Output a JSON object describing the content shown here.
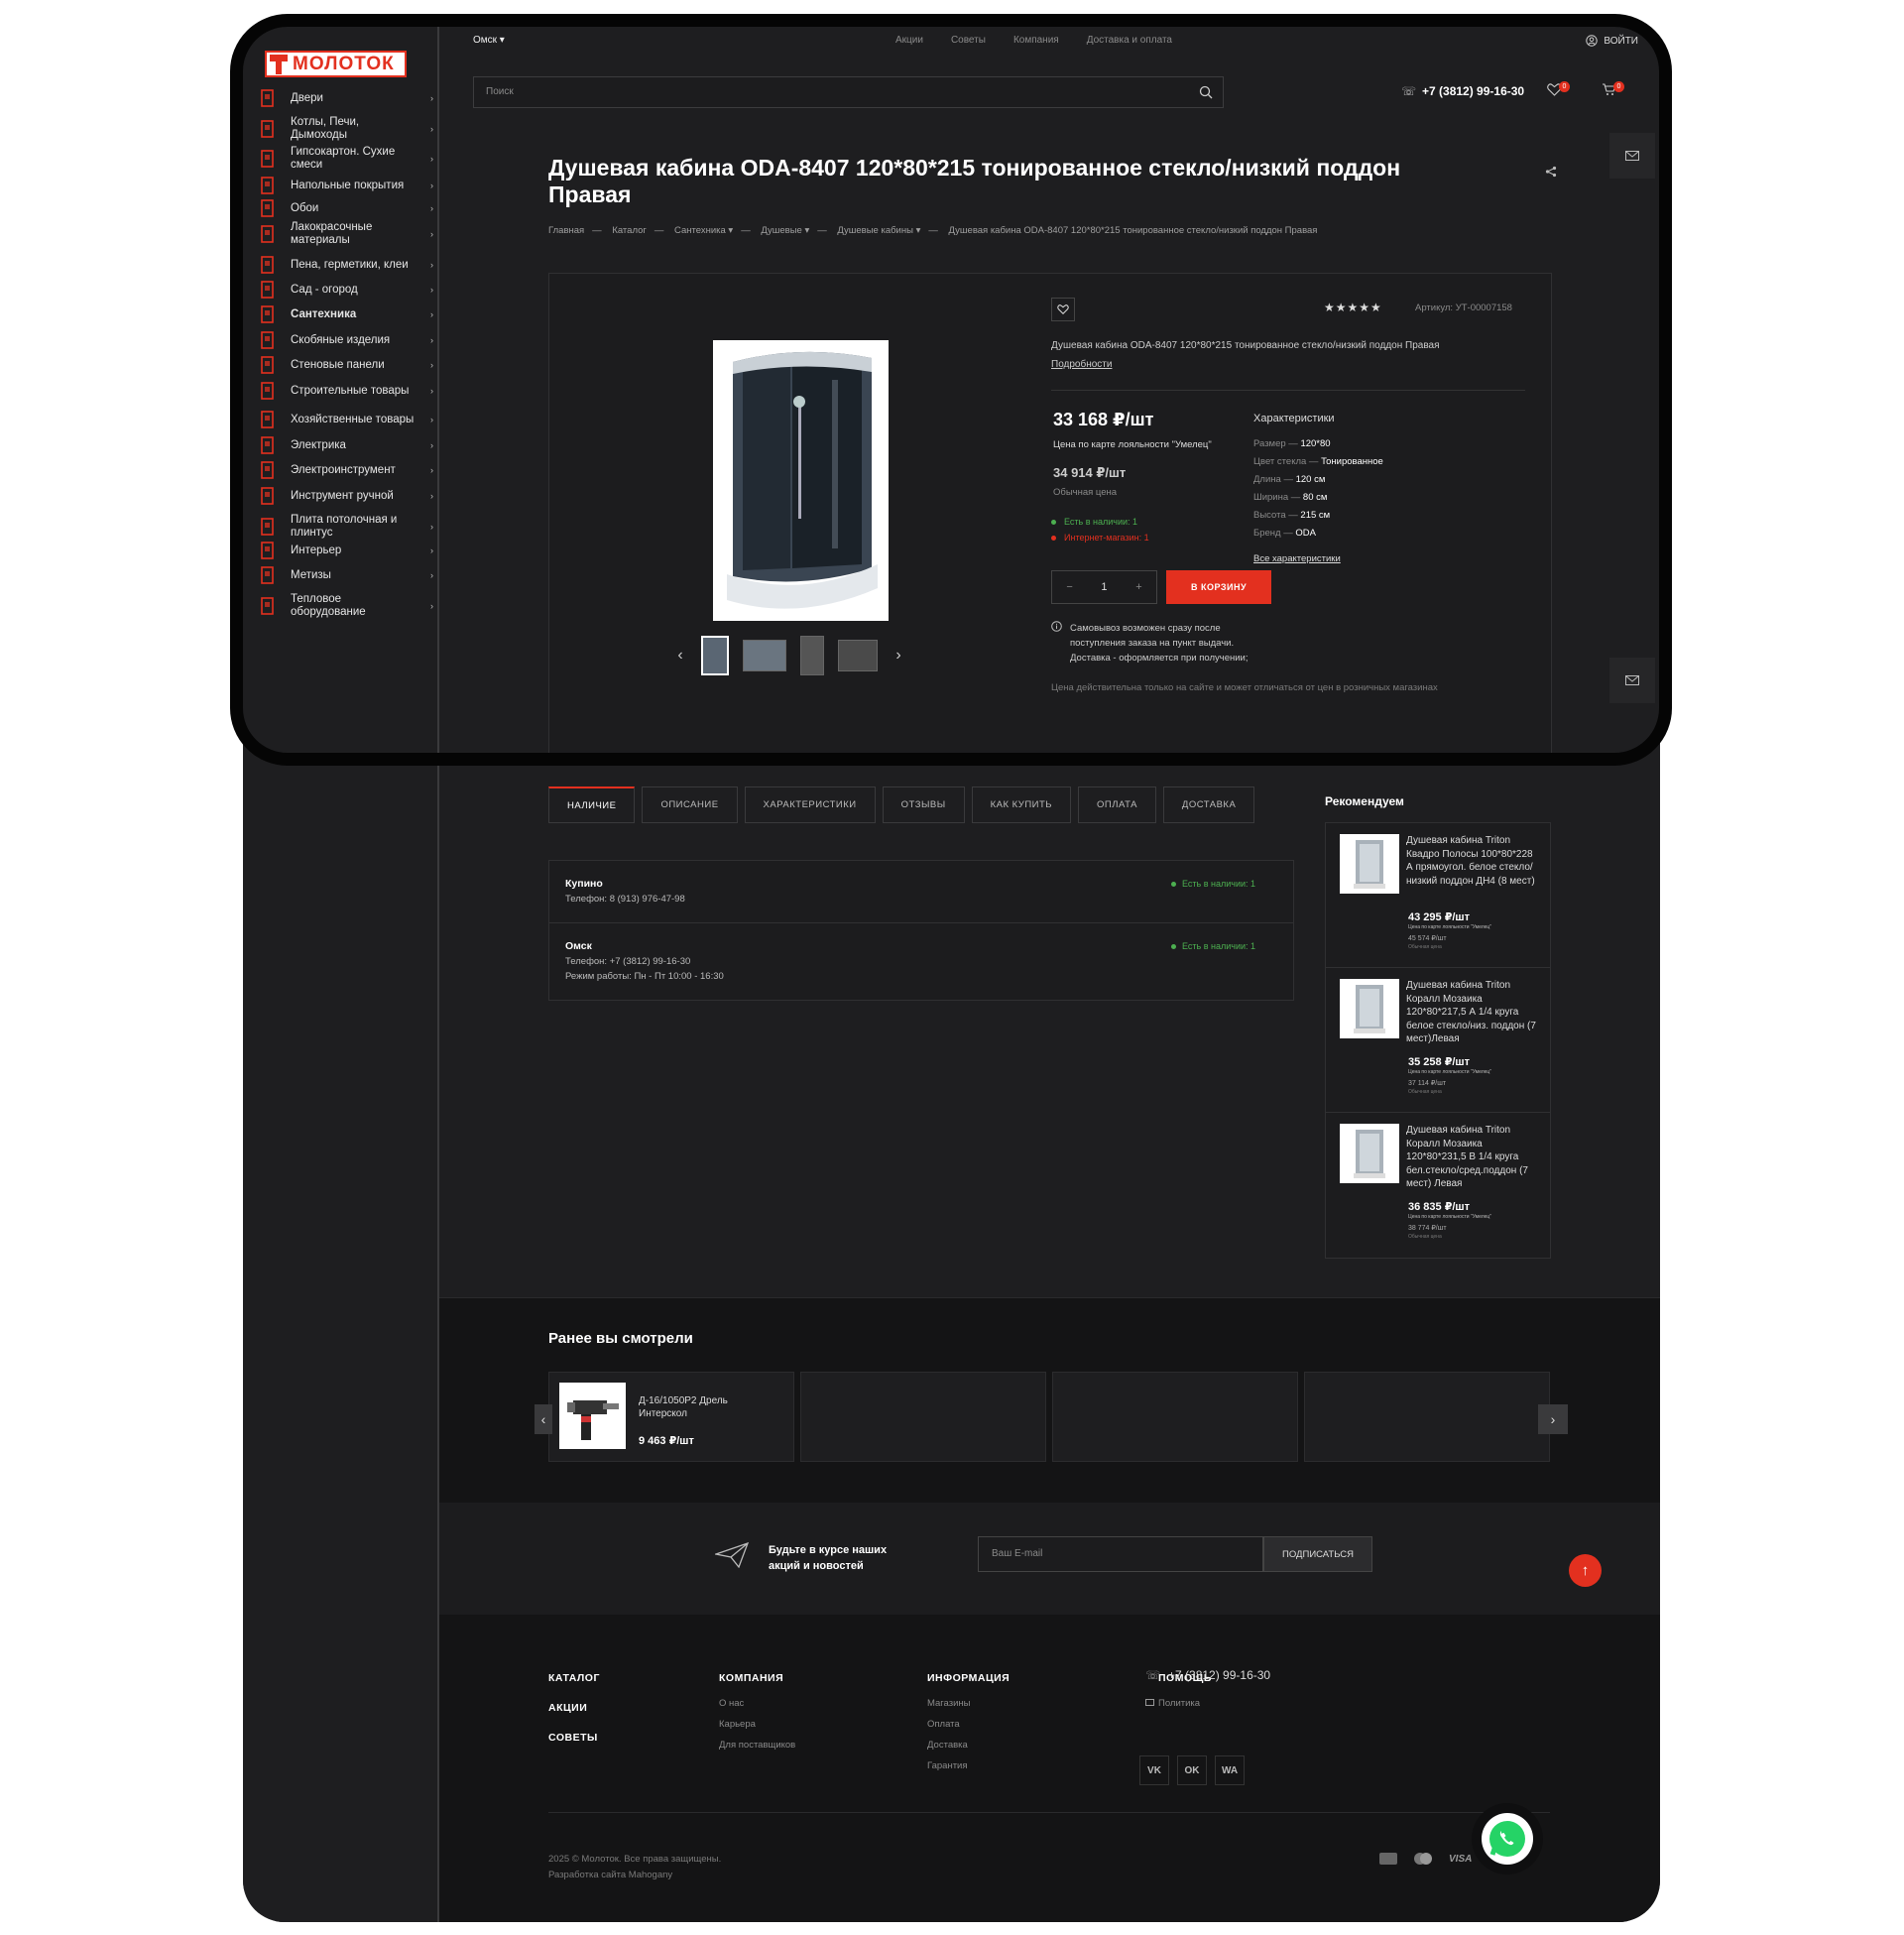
{
  "brand": {
    "name": "МОЛОТОК",
    "accent": "#e3301f"
  },
  "sidebar": {
    "items": [
      {
        "label": "Двери",
        "icon": "door-icon"
      },
      {
        "label": "Котлы, Печи, Дымоходы",
        "icon": "boiler-icon"
      },
      {
        "label": "Гипсокартон. Сухие смеси",
        "icon": "drywall-icon"
      },
      {
        "label": "Напольные покрытия",
        "icon": "floor-icon"
      },
      {
        "label": "Обои",
        "icon": "wallpaper-icon"
      },
      {
        "label": "Лакокрасочные материалы",
        "icon": "paint-roller-icon"
      },
      {
        "label": "Пена, герметики, клеи",
        "icon": "foam-icon"
      },
      {
        "label": "Сад - огород",
        "icon": "garden-icon"
      },
      {
        "label": "Сантехника",
        "icon": "plumbing-icon",
        "bold": true
      },
      {
        "label": "Скобяные изделия",
        "icon": "hardware-icon"
      },
      {
        "label": "Стеновые панели",
        "icon": "wall-panel-icon"
      },
      {
        "label": "Строительные товары",
        "icon": "building-icon"
      },
      {
        "label": "Хозяйственные товары",
        "icon": "household-icon"
      },
      {
        "label": "Электрика",
        "icon": "socket-icon"
      },
      {
        "label": "Электроинструмент",
        "icon": "power-tool-icon"
      },
      {
        "label": "Инструмент ручной",
        "icon": "hand-tool-icon"
      },
      {
        "label": "Плита потолочная и плинтус",
        "icon": "ceiling-icon"
      },
      {
        "label": "Интерьер",
        "icon": "interior-icon"
      },
      {
        "label": "Метизы",
        "icon": "bolt-icon"
      },
      {
        "label": "Тепловое оборудование",
        "icon": "heater-icon"
      }
    ]
  },
  "header": {
    "city": "Омск",
    "nav": [
      "Акции",
      "Советы",
      "Компания",
      "Доставка и оплата"
    ],
    "login": "ВОЙТИ",
    "search_placeholder": "Поиск",
    "phone": "+7 (3812) 99-16-30",
    "favorites_count": "0",
    "cart_count": "0"
  },
  "product": {
    "title": "Душевая кабина ODA-8407 120*80*215 тонированное стекло/низкий поддон Правая",
    "breadcrumbs": [
      "Главная",
      "Каталог",
      "Сантехника",
      "Душевые",
      "Душевые кабины",
      "Душевая кабина ODA-8407 120*80*215 тонированное стекло/низкий поддон Правая"
    ],
    "rating": "★★★★★",
    "sku": "Артикул: УТ-00007158",
    "description": "Душевая кабина ODA-8407 120*80*215 тонированное стекло/низкий поддон Правая",
    "more_link": "Подробности",
    "price_card": "33 168 ₽/шт",
    "price_card_label": "Цена по карте лояльности \"Умелец\"",
    "price_regular": "34 914 ₽/шт",
    "price_regular_label": "Обычная цена",
    "stock_shop": "Есть в наличии: 1",
    "stock_online": "Интернет-магазин: 1",
    "quantity": "1",
    "cart_button": "В КОРЗИНУ",
    "pickup_note": "Самовывоз возможен сразу после поступления заказа на пункт выдачи. Доставка - оформляется при получении;",
    "price_note": "Цена действительна только на сайте и может отличаться от цен в розничных магазинах",
    "chars_title": "Характеристики",
    "chars": [
      {
        "name": "Размер",
        "value": "120*80"
      },
      {
        "name": "Цвет стекла",
        "value": "Тонированное"
      },
      {
        "name": "Длина",
        "value": "120 см"
      },
      {
        "name": "Ширина",
        "value": "80 см"
      },
      {
        "name": "Высота",
        "value": "215 см"
      },
      {
        "name": "Бренд",
        "value": "ODA"
      }
    ],
    "all_chars": "Все характеристики"
  },
  "tabs": [
    "НАЛИЧИЕ",
    "ОПИСАНИЕ",
    "ХАРАКТЕРИСТИКИ",
    "ОТЗЫВЫ",
    "КАК КУПИТЬ",
    "ОПЛАТА",
    "ДОСТАВКА"
  ],
  "availability": [
    {
      "store": "Купино",
      "lines": [
        "Телефон: 8 (913) 976-47-98"
      ],
      "stock": "Есть в наличии: 1"
    },
    {
      "store": "Омск",
      "lines": [
        "Телефон: +7 (3812) 99-16-30",
        "Режим работы: Пн - Пт 10:00 - 16:30"
      ],
      "stock": "Есть в наличии: 1"
    }
  ],
  "recommend": {
    "title": "Рекомендуем",
    "items": [
      {
        "name": "Душевая кабина Triton Квадро Полосы 100*80*228 А прямоугол. белое стекло/низкий поддон ДН4 (8 мест)",
        "price": "43 295 ₽/шт",
        "price_label": "Цена по карте лояльности \"Умелец\"",
        "old_price": "45 574 ₽/шт",
        "old_label": "Обычная цена"
      },
      {
        "name": "Душевая кабина Triton Коралл Мозаика 120*80*217,5 А 1/4 круга белое стекло/низ. поддон (7 мест)Левая",
        "price": "35 258 ₽/шт",
        "price_label": "Цена по карте лояльности \"Умелец\"",
        "old_price": "37 114 ₽/шт",
        "old_label": "Обычная цена"
      },
      {
        "name": "Душевая кабина Triton Коралл Мозаика 120*80*231,5 В 1/4 круга бел.стекло/сред.поддон (7 мест) Левая",
        "price": "36 835 ₽/шт",
        "price_label": "Цена по карте лояльности \"Умелец\"",
        "old_price": "38 774 ₽/шт",
        "old_label": "Обычная цена"
      }
    ]
  },
  "viewed": {
    "title": "Ранее вы смотрели",
    "item": {
      "name": "Д-16/1050Р2 Дрель Интерскол",
      "price": "9 463 ₽/шт"
    }
  },
  "newsletter": {
    "text": "Будьте в курсе наших акций и новостей",
    "email_placeholder": "Ваш E-mail",
    "button": "ПОДПИСАТЬСЯ"
  },
  "footer": {
    "catalog": [
      "КАТАЛОГ",
      "АКЦИИ",
      "СОВЕТЫ"
    ],
    "company": {
      "title": "КОМПАНИЯ",
      "links": [
        "О нас",
        "Карьера",
        "Для поставщиков"
      ]
    },
    "info": {
      "title": "ИНФОРМАЦИЯ",
      "links": [
        "Магазины",
        "Оплата",
        "Доставка",
        "Гарантия"
      ]
    },
    "help": {
      "title": "ПОМОЩЬ",
      "links": [
        "Политика"
      ]
    },
    "phone": "+7 (3812) 99-16-30",
    "social": [
      "VK",
      "OK",
      "WA"
    ],
    "copyright": "2025 © Молоток. Все права защищены.",
    "developer": "Разработка сайта Mahogany",
    "payments": [
      "VISA"
    ]
  }
}
